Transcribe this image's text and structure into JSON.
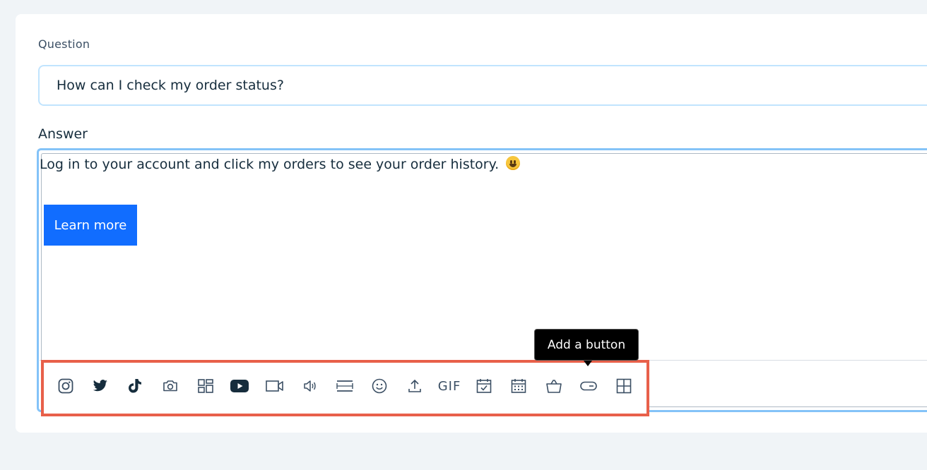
{
  "question": {
    "label": "Question",
    "value": "How can I check my order status?"
  },
  "answer": {
    "label": "Answer",
    "text": "Log in to your account and click my orders to see your order history.",
    "emoji": "grinning-face-emoji",
    "button_label": "Learn more"
  },
  "toolbar": {
    "tooltip": "Add a button",
    "gif_label": "GIF",
    "icons": [
      "instagram-icon",
      "twitter-icon",
      "tiktok-icon",
      "camera-icon",
      "gallery-icon",
      "youtube-icon",
      "video-icon",
      "audio-icon",
      "divider-icon",
      "emoji-icon",
      "upload-icon",
      "gif-icon",
      "event-icon",
      "calendar-icon",
      "shopping-bag-icon",
      "button-icon",
      "table-icon"
    ]
  },
  "colors": {
    "accent": "#116dff",
    "focus_border": "#84c3f8",
    "highlight": "#e8604a",
    "icon": "#3b4f64",
    "text": "#162d3d"
  }
}
